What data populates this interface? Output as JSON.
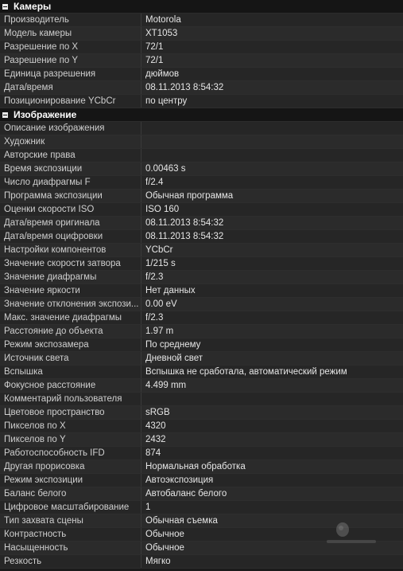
{
  "sections": [
    {
      "title": "Камеры",
      "rows": [
        {
          "name": "Производитель",
          "value": "Motorola"
        },
        {
          "name": "Модель камеры",
          "value": "XT1053"
        },
        {
          "name": "Разрешение по X",
          "value": "72/1"
        },
        {
          "name": "Разрешение по Y",
          "value": "72/1"
        },
        {
          "name": "Единица разрешения",
          "value": "дюймов"
        },
        {
          "name": "Дата/время",
          "value": "08.11.2013 8:54:32"
        },
        {
          "name": "Позиционирование YCbCr",
          "value": "по центру"
        }
      ]
    },
    {
      "title": "Изображение",
      "rows": [
        {
          "name": "Описание изображения",
          "value": ""
        },
        {
          "name": "Художник",
          "value": ""
        },
        {
          "name": "Авторские права",
          "value": ""
        },
        {
          "name": "Время экспозиции",
          "value": "0.00463 s"
        },
        {
          "name": "Число диафрагмы F",
          "value": "f/2.4"
        },
        {
          "name": "Программа экспозиции",
          "value": "Обычная программа"
        },
        {
          "name": "Оценки скорости ISO",
          "value": "ISO 160"
        },
        {
          "name": "Дата/время оригинала",
          "value": "08.11.2013 8:54:32"
        },
        {
          "name": "Дата/время оцифровки",
          "value": "08.11.2013 8:54:32"
        },
        {
          "name": "Настройки компонентов",
          "value": "YCbCr"
        },
        {
          "name": "Значение скорости затвора",
          "value": "1/215 s"
        },
        {
          "name": "Значение диафрагмы",
          "value": "f/2.3"
        },
        {
          "name": "Значение яркости",
          "value": "Нет данных"
        },
        {
          "name": "Значение отклонения экспози...",
          "value": "0.00 eV"
        },
        {
          "name": "Макс. значение диафрагмы",
          "value": "f/2.3"
        },
        {
          "name": "Расстояние до объекта",
          "value": "1.97 m"
        },
        {
          "name": "Режим экспозамера",
          "value": "По среднему"
        },
        {
          "name": "Источник света",
          "value": "Дневной свет"
        },
        {
          "name": "Вспышка",
          "value": "Вспышка не сработала, автоматический режим"
        },
        {
          "name": "Фокусное расстояние",
          "value": "4.499 mm"
        },
        {
          "name": "Комментарий пользователя",
          "value": ""
        },
        {
          "name": "Цветовое пространство",
          "value": "sRGB"
        },
        {
          "name": "Пикселов по X",
          "value": "4320"
        },
        {
          "name": "Пикселов по Y",
          "value": "2432"
        },
        {
          "name": "Работоспособность IFD",
          "value": "874"
        },
        {
          "name": "Другая прорисовка",
          "value": "Нормальная обработка"
        },
        {
          "name": "Режим экспозиции",
          "value": "Автоэкспозиция"
        },
        {
          "name": "Баланс белого",
          "value": "Автобаланс белого"
        },
        {
          "name": "Цифровое масштабирование",
          "value": "1"
        },
        {
          "name": "Тип захвата сцены",
          "value": "Обычная съемка"
        },
        {
          "name": "Контрастность",
          "value": "Обычное"
        },
        {
          "name": "Насыщенность",
          "value": "Обычное"
        },
        {
          "name": "Резкость",
          "value": "Мягко"
        }
      ]
    }
  ]
}
